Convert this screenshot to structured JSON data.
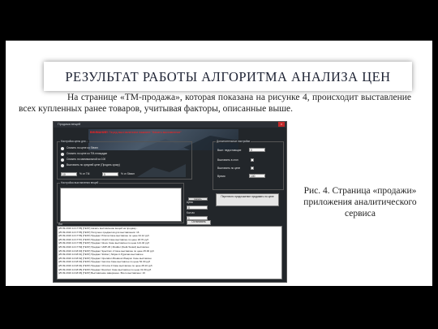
{
  "slide": {
    "title": "РЕЗУЛЬТАТ РАБОТЫ АЛГОРИТМА АНАЛИЗА ЦЕН",
    "paragraph": "На странице «TM-продажа», которая показана на рисунке 4, происходит выставление всех купленных ранее товаров, учитывая факторы, описанные выше.",
    "caption": "Рис. 4. Страница «продажи» приложения аналитического сервиса"
  },
  "screenshot": {
    "window_title": "Продажа вещей",
    "close_glyph": "×",
    "banner": {
      "label": "ВНИМАНИЕ!",
      "text": "Перед выставлением нажмите \"Начать выставление\""
    },
    "price_group": {
      "label": "Настройка цены для ...",
      "radios": [
        "Снизить по цене из Steam",
        "Снизить по цене из TM-площадки",
        "Снизить по минимальной из 100",
        "Выставить по средней цене (Продать сразу)"
      ],
      "field_a": "10",
      "field_a_label": "% от ТМ",
      "field_b": "5",
      "field_b_label": "% от Steam"
    },
    "extra_group": {
      "label": "Дополнительные настройки",
      "rows": [
        "Выст. недостающие",
        "Выставить в стоп",
        "Выставить по цене",
        "Время"
      ],
      "values": [
        "0",
        "",
        "",
        "100"
      ]
    },
    "items_group": {
      "label": "Настройка выставления вещей"
    },
    "side": {
      "price_label": "Цена",
      "price_value": "0",
      "qty_label": "Кол-во",
      "qty_value": "1",
      "start_label": "Начать",
      "stop_label": "Остановить",
      "action_button": "Перенести предложение продавать по цене"
    },
    "log_label": "Лог",
    "log_rows": [
      "[25.09.2019 14:17:55] [TEST] Начать выставление вещей на продажу...",
      "[25.09.2019 14:17:55] [TEST] Получено предметов для выставления: 16",
      "[25.09.2019 14:17:56] [TEST] Предмет Prisma Case выставлен по цене 34.12 руб",
      "[25.09.2019 14:17:57] [TEST] Предмет Clutch Case выставлен по цене 18.70 руб",
      "[25.09.2019 14:17:58] [TEST] Предмет Glove Case выставлен по цене 121.40 руб",
      "[25.09.2019 14:17:59] [TEST] Предмет UMP-45 | Mudder (Field-Tested) выставлен",
      "[25.09.2019 14:18:00] [TEST] Предмет Spectrum 2 Case выставлен по цене 45.00 руб",
      "[25.09.2019 14:18:01] [TEST] Предмет Sticker | Ninjas in Pyjamas выставлен",
      "[25.09.2019 14:18:02] [TEST] Предмет Operation Breakout Weapon Case выставлен",
      "[25.09.2019 14:18:03] [TEST] Предмет Gamma Case выставлен по цене 52.30 руб",
      "[25.09.2019 14:18:04] [TEST] Предмет Chroma 3 Case выставлен по цене 28.10 руб",
      "[25.09.2019 14:18:05] [TEST] Предмет Revolver Case выставлен по цене 31.60 руб",
      "[25.09.2019 14:18:06] [TEST] Выставление завершено. Всего выставлено: 16"
    ]
  }
}
